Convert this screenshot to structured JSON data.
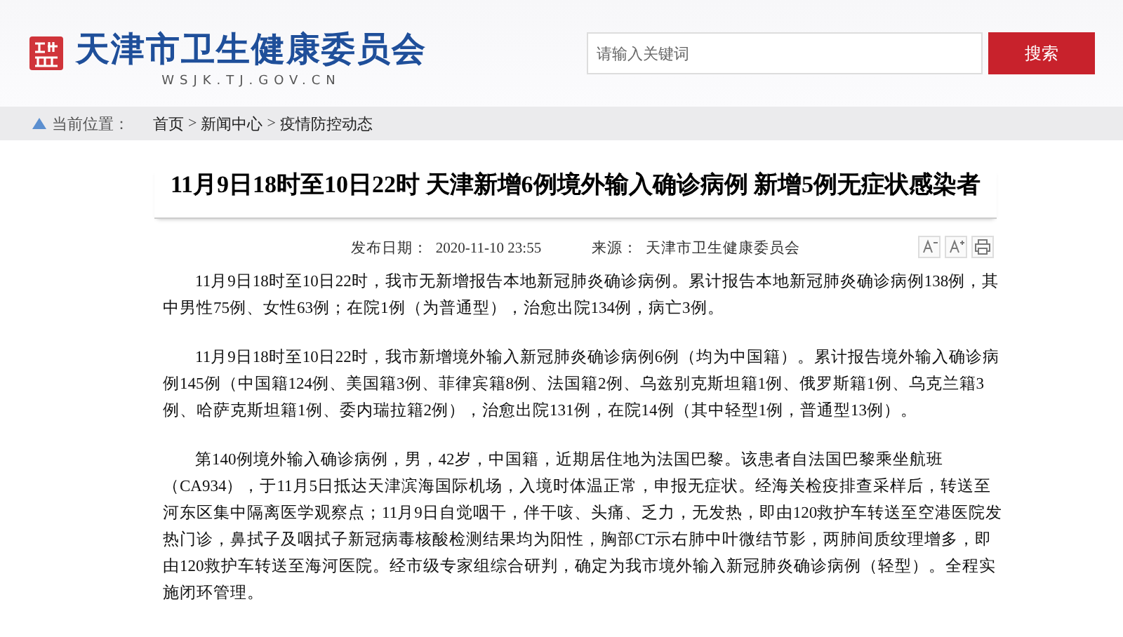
{
  "header": {
    "site_name": "天津市卫生健康委员会",
    "domain": "WSJK.TJ.GOV.CN",
    "search": {
      "placeholder": "请输入关键词"
    },
    "search_button": "搜索"
  },
  "breadcrumb": {
    "label": "当前位置：",
    "separator": ">",
    "items": [
      "首页",
      "新闻中心",
      "疫情防控动态"
    ]
  },
  "article": {
    "title": "11月9日18时至10日22时 天津新增6例境外输入确诊病例 新增5例无症状感染者",
    "meta": [
      {
        "label": "发布日期：",
        "value": "2020-11-10 23:55"
      },
      {
        "label": "来源：",
        "value": "天津市卫生健康委员会"
      }
    ],
    "tools": [
      {
        "kind": "smaller"
      },
      {
        "kind": "larger"
      },
      {
        "kind": "print"
      }
    ],
    "paragraphs": [
      "11月9日18时至10日22时，我市无新增报告本地新冠肺炎确诊病例。累计报告本地新冠肺炎确诊病例138例，其中男性75例、女性63例；在院1例（为普通型），治愈出院134例，病亡3例。",
      "11月9日18时至10日22时，我市新增境外输入新冠肺炎确诊病例6例（均为中国籍）。累计报告境外输入确诊病例145例（中国籍124例、美国籍3例、菲律宾籍8例、法国籍2例、乌兹别克斯坦籍1例、俄罗斯籍1例、乌克兰籍3例、哈萨克斯坦籍1例、委内瑞拉籍2例），治愈出院131例，在院14例（其中轻型1例，普通型13例）。",
      "第140例境外输入确诊病例，男，42岁，中国籍，近期居住地为法国巴黎。该患者自法国巴黎乘坐航班（CA934），于11月5日抵达天津滨海国际机场，入境时体温正常，申报无症状。经海关检疫排查采样后，转送至河东区集中隔离医学观察点；11月9日自觉咽干，伴干咳、头痛、乏力，无发热，即由120救护车转送至空港医院发热门诊，鼻拭子及咽拭子新冠病毒核酸检测结果均为阳性，胸部CT示右肺中叶微结节影，两肺间质纹理增多，即由120救护车转送至海河医院。经市级专家组综合研判，确定为我市境外输入新冠肺炎确诊病例（轻型）。全程实施闭环管理。"
    ]
  }
}
